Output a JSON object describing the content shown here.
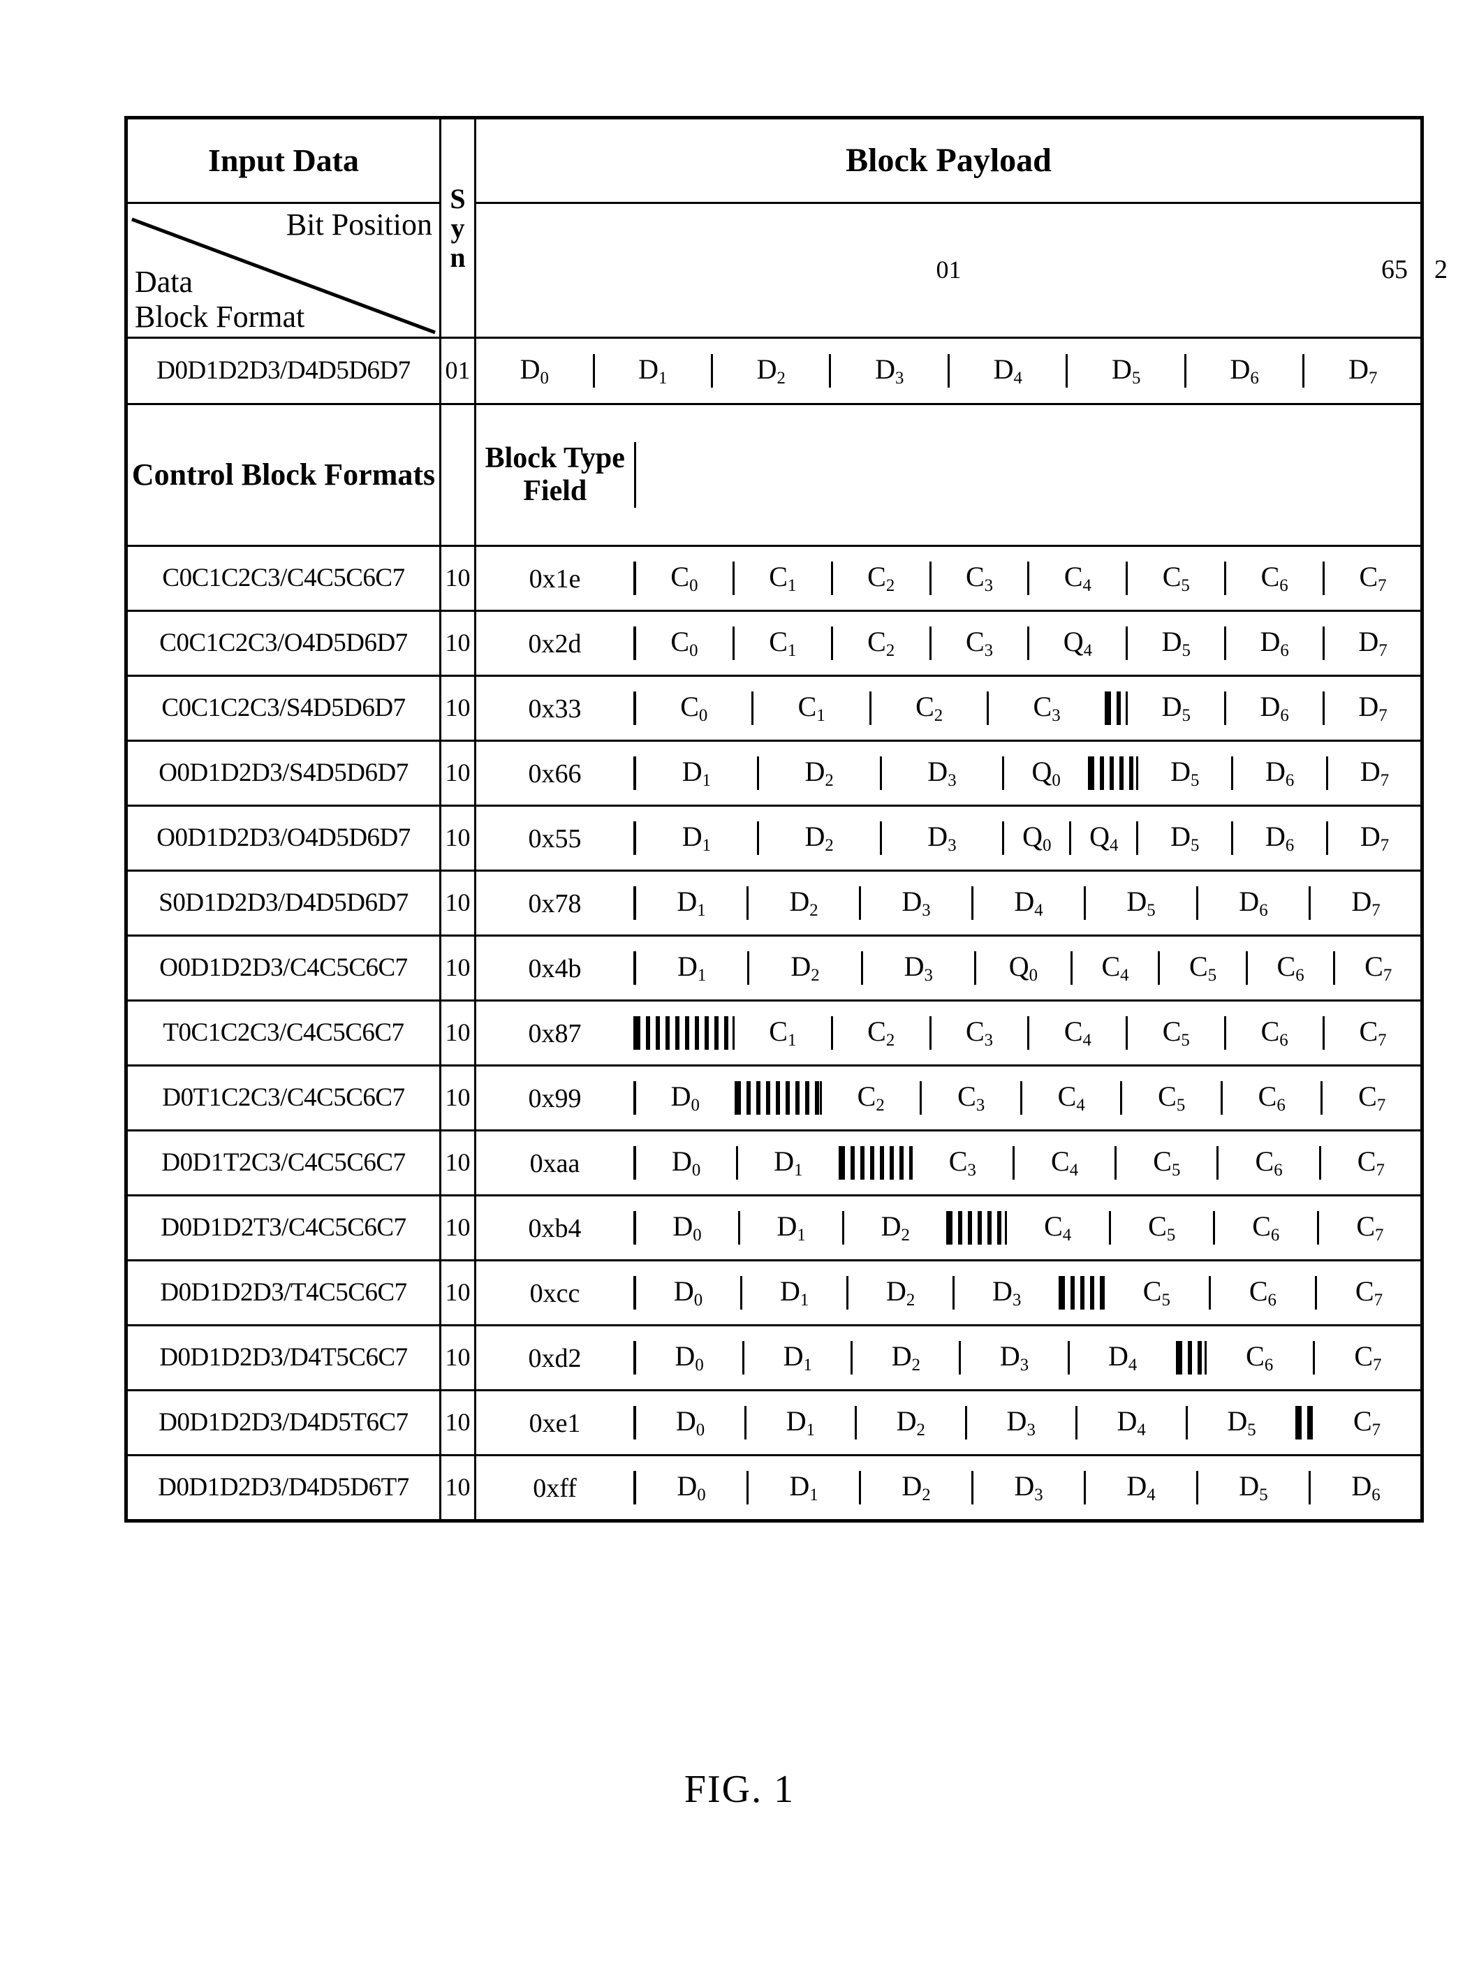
{
  "figure": {
    "caption": "FIG. 1"
  },
  "header": {
    "input_data": "Input Data",
    "sync_label_chars": [
      "S",
      "y",
      "n"
    ],
    "block_payload": "Block Payload",
    "bit_position": "Bit Position",
    "data_block_format_line1": "Data",
    "data_block_format_line2": "Block Format",
    "sync_value_data": "01",
    "payload_bit_low": "2",
    "payload_bit_high": "65",
    "control_block_formats": "Control Block Formats",
    "block_type_field": "Block Type Field"
  },
  "data_row": {
    "label": "D0D1D2D3/D4D5D6D7",
    "sync": "01",
    "cells": [
      {
        "t": "D",
        "s": "0"
      },
      {
        "t": "D",
        "s": "1"
      },
      {
        "t": "D",
        "s": "2"
      },
      {
        "t": "D",
        "s": "3"
      },
      {
        "t": "D",
        "s": "4"
      },
      {
        "t": "D",
        "s": "5"
      },
      {
        "t": "D",
        "s": "6"
      },
      {
        "t": "D",
        "s": "7"
      }
    ]
  },
  "control_rows": [
    {
      "label": "C0C1C2C3/C4C5C6C7",
      "sync": "10",
      "type": "0x1e",
      "cells": [
        {
          "t": "C",
          "s": "0",
          "w": 1
        },
        {
          "t": "C",
          "s": "1",
          "w": 1
        },
        {
          "t": "C",
          "s": "2",
          "w": 1
        },
        {
          "t": "C",
          "s": "3",
          "w": 1
        },
        {
          "t": "C",
          "s": "4",
          "w": 1
        },
        {
          "t": "C",
          "s": "5",
          "w": 1
        },
        {
          "t": "C",
          "s": "6",
          "w": 1
        },
        {
          "t": "C",
          "s": "7",
          "w": 1
        }
      ]
    },
    {
      "label": "C0C1C2C3/O4D5D6D7",
      "sync": "10",
      "type": "0x2d",
      "cells": [
        {
          "t": "C",
          "s": "0",
          "w": 1
        },
        {
          "t": "C",
          "s": "1",
          "w": 1
        },
        {
          "t": "C",
          "s": "2",
          "w": 1
        },
        {
          "t": "C",
          "s": "3",
          "w": 1
        },
        {
          "t": "Q",
          "s": "4",
          "w": 1
        },
        {
          "t": "D",
          "s": "5",
          "w": 1
        },
        {
          "t": "D",
          "s": "6",
          "w": 1
        },
        {
          "t": "D",
          "s": "7",
          "w": 1
        }
      ]
    },
    {
      "label": "C0C1C2C3/S4D5D6D7",
      "sync": "10",
      "type": "0x33",
      "cells": [
        {
          "t": "C",
          "s": "0",
          "w": 1.2
        },
        {
          "t": "C",
          "s": "1",
          "w": 1.2
        },
        {
          "t": "C",
          "s": "2",
          "w": 1.2
        },
        {
          "t": "C",
          "s": "3",
          "w": 1.2
        },
        {
          "hatch": true,
          "w": 0.2
        },
        {
          "t": "D",
          "s": "5",
          "w": 1
        },
        {
          "t": "D",
          "s": "6",
          "w": 1
        },
        {
          "t": "D",
          "s": "7",
          "w": 1
        }
      ]
    },
    {
      "label": "O0D1D2D3/S4D5D6D7",
      "sync": "10",
      "type": "0x66",
      "cells": [
        {
          "t": "D",
          "s": "1",
          "w": 1.3
        },
        {
          "t": "D",
          "s": "2",
          "w": 1.3
        },
        {
          "t": "D",
          "s": "3",
          "w": 1.3
        },
        {
          "t": "Q",
          "s": "0",
          "w": 0.9
        },
        {
          "hatch": true,
          "w": 0.5
        },
        {
          "t": "D",
          "s": "5",
          "w": 1
        },
        {
          "t": "D",
          "s": "6",
          "w": 1
        },
        {
          "t": "D",
          "s": "7",
          "w": 1
        }
      ]
    },
    {
      "label": "O0D1D2D3/O4D5D6D7",
      "sync": "10",
      "type": "0x55",
      "cells": [
        {
          "t": "D",
          "s": "1",
          "w": 1.3
        },
        {
          "t": "D",
          "s": "2",
          "w": 1.3
        },
        {
          "t": "D",
          "s": "3",
          "w": 1.3
        },
        {
          "t": "Q",
          "s": "0",
          "w": 0.7
        },
        {
          "t": "Q",
          "s": "4",
          "w": 0.7
        },
        {
          "t": "D",
          "s": "5",
          "w": 1
        },
        {
          "t": "D",
          "s": "6",
          "w": 1
        },
        {
          "t": "D",
          "s": "7",
          "w": 1
        }
      ]
    },
    {
      "label": "S0D1D2D3/D4D5D6D7",
      "sync": "10",
      "type": "0x78",
      "cells": [
        {
          "t": "D",
          "s": "1",
          "w": 1
        },
        {
          "t": "D",
          "s": "2",
          "w": 1
        },
        {
          "t": "D",
          "s": "3",
          "w": 1
        },
        {
          "t": "D",
          "s": "4",
          "w": 1
        },
        {
          "t": "D",
          "s": "5",
          "w": 1
        },
        {
          "t": "D",
          "s": "6",
          "w": 1
        },
        {
          "t": "D",
          "s": "7",
          "w": 1
        }
      ]
    },
    {
      "label": "O0D1D2D3/C4C5C6C7",
      "sync": "10",
      "type": "0x4b",
      "cells": [
        {
          "t": "D",
          "s": "1",
          "w": 1.3
        },
        {
          "t": "D",
          "s": "2",
          "w": 1.3
        },
        {
          "t": "D",
          "s": "3",
          "w": 1.3
        },
        {
          "t": "Q",
          "s": "0",
          "w": 1.1
        },
        {
          "t": "C",
          "s": "4",
          "w": 1
        },
        {
          "t": "C",
          "s": "5",
          "w": 1
        },
        {
          "t": "C",
          "s": "6",
          "w": 1
        },
        {
          "t": "C",
          "s": "7",
          "w": 1
        }
      ]
    },
    {
      "label": "T0C1C2C3/C4C5C6C7",
      "sync": "10",
      "type": "0x87",
      "cells": [
        {
          "hatch": true,
          "w": 1.0
        },
        {
          "t": "C",
          "s": "1",
          "w": 1
        },
        {
          "t": "C",
          "s": "2",
          "w": 1
        },
        {
          "t": "C",
          "s": "3",
          "w": 1
        },
        {
          "t": "C",
          "s": "4",
          "w": 1
        },
        {
          "t": "C",
          "s": "5",
          "w": 1
        },
        {
          "t": "C",
          "s": "6",
          "w": 1
        },
        {
          "t": "C",
          "s": "7",
          "w": 1
        }
      ]
    },
    {
      "label": "D0T1C2C3/C4C5C6C7",
      "sync": "10",
      "type": "0x99",
      "cells": [
        {
          "t": "D",
          "s": "0",
          "w": 1
        },
        {
          "hatch": true,
          "w": 0.85
        },
        {
          "t": "C",
          "s": "2",
          "w": 1
        },
        {
          "t": "C",
          "s": "3",
          "w": 1
        },
        {
          "t": "C",
          "s": "4",
          "w": 1
        },
        {
          "t": "C",
          "s": "5",
          "w": 1
        },
        {
          "t": "C",
          "s": "6",
          "w": 1
        },
        {
          "t": "C",
          "s": "7",
          "w": 1
        }
      ]
    },
    {
      "label": "D0D1T2C3/C4C5C6C7",
      "sync": "10",
      "type": "0xaa",
      "cells": [
        {
          "t": "D",
          "s": "0",
          "w": 1
        },
        {
          "t": "D",
          "s": "1",
          "w": 1
        },
        {
          "hatch": true,
          "w": 0.7
        },
        {
          "t": "C",
          "s": "3",
          "w": 1
        },
        {
          "t": "C",
          "s": "4",
          "w": 1
        },
        {
          "t": "C",
          "s": "5",
          "w": 1
        },
        {
          "t": "C",
          "s": "6",
          "w": 1
        },
        {
          "t": "C",
          "s": "7",
          "w": 1
        }
      ]
    },
    {
      "label": "D0D1D2T3/C4C5C6C7",
      "sync": "10",
      "type": "0xb4",
      "cells": [
        {
          "t": "D",
          "s": "0",
          "w": 1
        },
        {
          "t": "D",
          "s": "1",
          "w": 1
        },
        {
          "t": "D",
          "s": "2",
          "w": 1
        },
        {
          "hatch": true,
          "w": 0.55
        },
        {
          "t": "C",
          "s": "4",
          "w": 1
        },
        {
          "t": "C",
          "s": "5",
          "w": 1
        },
        {
          "t": "C",
          "s": "6",
          "w": 1
        },
        {
          "t": "C",
          "s": "7",
          "w": 1
        }
      ]
    },
    {
      "label": "D0D1D2D3/T4C5C6C7",
      "sync": "10",
      "type": "0xcc",
      "cells": [
        {
          "t": "D",
          "s": "0",
          "w": 1
        },
        {
          "t": "D",
          "s": "1",
          "w": 1
        },
        {
          "t": "D",
          "s": "2",
          "w": 1
        },
        {
          "t": "D",
          "s": "3",
          "w": 1
        },
        {
          "hatch": true,
          "w": 0.4
        },
        {
          "t": "C",
          "s": "5",
          "w": 1
        },
        {
          "t": "C",
          "s": "6",
          "w": 1
        },
        {
          "t": "C",
          "s": "7",
          "w": 1
        }
      ]
    },
    {
      "label": "D0D1D2D3/D4T5C6C7",
      "sync": "10",
      "type": "0xd2",
      "cells": [
        {
          "t": "D",
          "s": "0",
          "w": 1
        },
        {
          "t": "D",
          "s": "1",
          "w": 1
        },
        {
          "t": "D",
          "s": "2",
          "w": 1
        },
        {
          "t": "D",
          "s": "3",
          "w": 1
        },
        {
          "t": "D",
          "s": "4",
          "w": 1
        },
        {
          "hatch": true,
          "w": 0.25
        },
        {
          "t": "C",
          "s": "6",
          "w": 1
        },
        {
          "t": "C",
          "s": "7",
          "w": 1
        }
      ]
    },
    {
      "label": "D0D1D2D3/D4D5T6C7",
      "sync": "10",
      "type": "0xe1",
      "cells": [
        {
          "t": "D",
          "s": "0",
          "w": 1
        },
        {
          "t": "D",
          "s": "1",
          "w": 1
        },
        {
          "t": "D",
          "s": "2",
          "w": 1
        },
        {
          "t": "D",
          "s": "3",
          "w": 1
        },
        {
          "t": "D",
          "s": "4",
          "w": 1
        },
        {
          "t": "D",
          "s": "5",
          "w": 1
        },
        {
          "hatch": true,
          "w": 0.12
        },
        {
          "t": "C",
          "s": "7",
          "w": 1
        }
      ]
    },
    {
      "label": "D0D1D2D3/D4D5D6T7",
      "sync": "10",
      "type": "0xff",
      "cells": [
        {
          "t": "D",
          "s": "0",
          "w": 1
        },
        {
          "t": "D",
          "s": "1",
          "w": 1
        },
        {
          "t": "D",
          "s": "2",
          "w": 1
        },
        {
          "t": "D",
          "s": "3",
          "w": 1
        },
        {
          "t": "D",
          "s": "4",
          "w": 1
        },
        {
          "t": "D",
          "s": "5",
          "w": 1
        },
        {
          "t": "D",
          "s": "6",
          "w": 1
        }
      ]
    }
  ]
}
